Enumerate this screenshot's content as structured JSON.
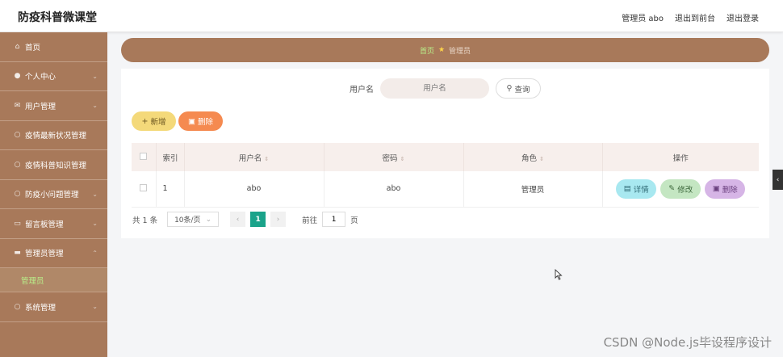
{
  "app": {
    "title": "防疫科普微课堂",
    "user_label": "管理员 abo",
    "to_frontend": "退出到前台",
    "logout": "退出登录"
  },
  "sidebar": {
    "items": [
      {
        "label": "首页",
        "icon": "home-icon"
      },
      {
        "label": "个人中心",
        "icon": "user-icon"
      },
      {
        "label": "用户管理",
        "icon": "mail-icon"
      },
      {
        "label": "疫情最新状况管理",
        "icon": "circle-icon"
      },
      {
        "label": "疫情科普知识管理",
        "icon": "circle-icon"
      },
      {
        "label": "防疫小问题管理",
        "icon": "circle-icon"
      },
      {
        "label": "留言板管理",
        "icon": "chat-icon"
      },
      {
        "label": "管理员管理",
        "icon": "briefcase-icon"
      },
      {
        "label": "系统管理",
        "icon": "circle-icon"
      }
    ],
    "sub_item": "管理员"
  },
  "breadcrumb": {
    "home": "首页",
    "current": "管理员"
  },
  "search": {
    "label": "用户名",
    "placeholder": "用户名",
    "button": "查询"
  },
  "actions": {
    "add": "新增",
    "delete": "删除"
  },
  "table": {
    "headers": {
      "index": "索引",
      "username": "用户名",
      "password": "密码",
      "role": "角色",
      "ops": "操作"
    },
    "rows": [
      {
        "index": "1",
        "username": "abo",
        "password": "abo",
        "role": "管理员"
      }
    ],
    "row_buttons": {
      "detail": "详情",
      "edit": "修改",
      "delete": "删除"
    }
  },
  "pagination": {
    "total": "共 1 条",
    "page_size": "10条/页",
    "current": "1",
    "goto_label": "前往",
    "goto_value": "1",
    "page_suffix": "页"
  },
  "watermark": "CSDN @Node.js毕设程序设计",
  "colors": {
    "sidebar": "#a8795a",
    "accent_green": "#1aa38a",
    "add_button": "#f4d97a",
    "delete_button": "#f58a50"
  }
}
